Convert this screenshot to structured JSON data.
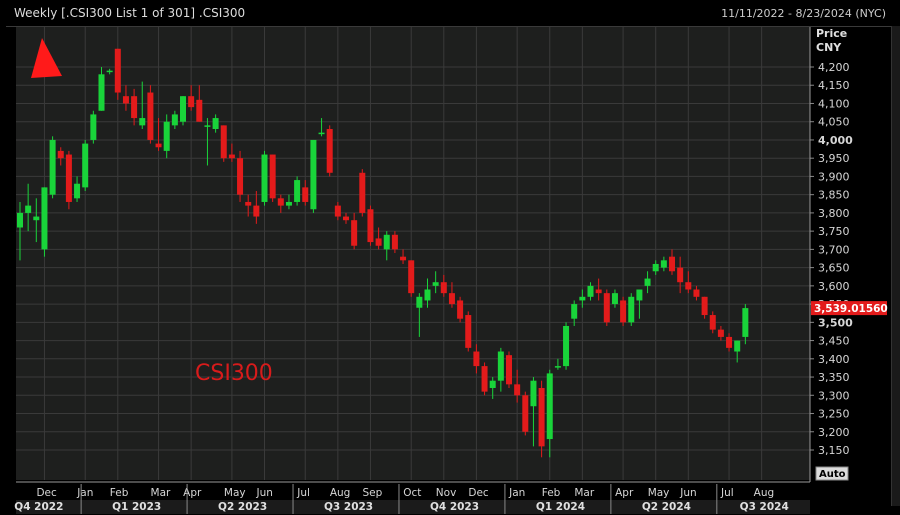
{
  "header": {
    "title": "Weekly [.CSI300 List 1 of 301] .CSI300",
    "date_range": "11/11/2022 - 8/23/2024 (NYC)"
  },
  "axis": {
    "price_label": "Price",
    "currency_label": "CNY",
    "auto_button": "Auto",
    "last_price_tag": "3,539.01560"
  },
  "watermark": "CSI300",
  "colors": {
    "up": "#19d43a",
    "down": "#e31b1b",
    "background": "#1e1f1e",
    "grid": "#3a3a3a",
    "marker": "#ff1a1a"
  },
  "chart_data": {
    "type": "candlestick",
    "title": "Weekly [.CSI300 List 1 of 301] .CSI300",
    "interval": "Weekly",
    "ylabel": "Price CNY",
    "ylim": [
      3120,
      4290
    ],
    "y_ticks": [
      3150,
      3200,
      3250,
      3300,
      3350,
      3400,
      3450,
      3500,
      3550,
      3600,
      3650,
      3700,
      3750,
      3800,
      3850,
      3900,
      3950,
      4000,
      4050,
      4100,
      4150,
      4200
    ],
    "y_tick_labels": [
      "3,150",
      "3,200",
      "3,250",
      "3,300",
      "3,350",
      "3,400",
      "3,450",
      "3,500",
      "3,550",
      "3,600",
      "3,650",
      "3,700",
      "3,750",
      "3,800",
      "3,850",
      "3,900",
      "3,950",
      "4,000",
      "4,050",
      "4,100",
      "4,150",
      "4,200"
    ],
    "month_labels": [
      "Dec",
      "Jan",
      "Feb",
      "Mar",
      "Apr",
      "May",
      "Jun",
      "Jul",
      "Aug",
      "Sep",
      "Oct",
      "Nov",
      "Dec",
      "Jan",
      "Feb",
      "Mar",
      "Apr",
      "May",
      "Jun",
      "Jul",
      "Aug"
    ],
    "month_label_week_index": [
      3,
      8,
      12,
      17,
      21,
      26,
      30,
      35,
      39,
      43,
      48,
      52,
      56,
      61,
      65,
      69,
      74,
      78,
      82,
      87,
      91
    ],
    "quarter_labels": [
      "Q4 2022",
      "Q1 2023",
      "Q2 2023",
      "Q3 2023",
      "Q4 2023",
      "Q1 2024",
      "Q2 2024",
      "Q3 2024"
    ],
    "quarter_label_week_index": [
      2,
      14,
      27,
      40,
      53,
      66,
      79,
      91
    ],
    "quarter_separator_week_index": [
      7.5,
      20.5,
      33.5,
      46.5,
      59.5,
      72.5,
      85.5
    ],
    "last_price": 3539.0156,
    "candles": [
      {
        "o": 3760,
        "h": 3830,
        "l": 3670,
        "c": 3800
      },
      {
        "o": 3800,
        "h": 3880,
        "l": 3750,
        "c": 3820
      },
      {
        "o": 3780,
        "h": 3840,
        "l": 3720,
        "c": 3790
      },
      {
        "o": 3700,
        "h": 3870,
        "l": 3680,
        "c": 3870
      },
      {
        "o": 3850,
        "h": 4010,
        "l": 3840,
        "c": 4000
      },
      {
        "o": 3970,
        "h": 3980,
        "l": 3930,
        "c": 3950
      },
      {
        "o": 3960,
        "h": 3970,
        "l": 3810,
        "c": 3830
      },
      {
        "o": 3840,
        "h": 3900,
        "l": 3830,
        "c": 3880
      },
      {
        "o": 3870,
        "h": 4000,
        "l": 3860,
        "c": 3990
      },
      {
        "o": 4000,
        "h": 4080,
        "l": 3990,
        "c": 4070
      },
      {
        "o": 4080,
        "h": 4200,
        "l": 4080,
        "c": 4180
      },
      {
        "o": 4190,
        "h": 4195,
        "l": 4180,
        "c": 4190
      },
      {
        "o": 4250,
        "h": 4250,
        "l": 4110,
        "c": 4130
      },
      {
        "o": 4120,
        "h": 4150,
        "l": 4080,
        "c": 4100
      },
      {
        "o": 4120,
        "h": 4140,
        "l": 4040,
        "c": 4060
      },
      {
        "o": 4040,
        "h": 4160,
        "l": 4030,
        "c": 4060
      },
      {
        "o": 4130,
        "h": 4150,
        "l": 3990,
        "c": 4000
      },
      {
        "o": 3990,
        "h": 4060,
        "l": 3970,
        "c": 3980
      },
      {
        "o": 3970,
        "h": 4070,
        "l": 3950,
        "c": 4050
      },
      {
        "o": 4040,
        "h": 4080,
        "l": 4030,
        "c": 4070
      },
      {
        "o": 4050,
        "h": 4120,
        "l": 4040,
        "c": 4120
      },
      {
        "o": 4120,
        "h": 4150,
        "l": 4080,
        "c": 4090
      },
      {
        "o": 4110,
        "h": 4150,
        "l": 4050,
        "c": 4050
      },
      {
        "o": 4040,
        "h": 4060,
        "l": 3930,
        "c": 4040
      },
      {
        "o": 4030,
        "h": 4070,
        "l": 4020,
        "c": 4060
      },
      {
        "o": 4040,
        "h": 4040,
        "l": 3940,
        "c": 3950
      },
      {
        "o": 3960,
        "h": 3990,
        "l": 3940,
        "c": 3950
      },
      {
        "o": 3950,
        "h": 3970,
        "l": 3830,
        "c": 3850
      },
      {
        "o": 3830,
        "h": 3850,
        "l": 3790,
        "c": 3820
      },
      {
        "o": 3820,
        "h": 3860,
        "l": 3770,
        "c": 3790
      },
      {
        "o": 3830,
        "h": 3970,
        "l": 3820,
        "c": 3960
      },
      {
        "o": 3960,
        "h": 3960,
        "l": 3830,
        "c": 3840
      },
      {
        "o": 3840,
        "h": 3850,
        "l": 3800,
        "c": 3820
      },
      {
        "o": 3820,
        "h": 3850,
        "l": 3810,
        "c": 3830
      },
      {
        "o": 3830,
        "h": 3900,
        "l": 3820,
        "c": 3890
      },
      {
        "o": 3870,
        "h": 3890,
        "l": 3820,
        "c": 3830
      },
      {
        "o": 3810,
        "h": 4000,
        "l": 3800,
        "c": 4000
      },
      {
        "o": 4020,
        "h": 4060,
        "l": 4010,
        "c": 4020
      },
      {
        "o": 4030,
        "h": 4040,
        "l": 3900,
        "c": 3910
      },
      {
        "o": 3820,
        "h": 3830,
        "l": 3780,
        "c": 3790
      },
      {
        "o": 3790,
        "h": 3800,
        "l": 3770,
        "c": 3780
      },
      {
        "o": 3780,
        "h": 3800,
        "l": 3700,
        "c": 3710
      },
      {
        "o": 3910,
        "h": 3920,
        "l": 3790,
        "c": 3800
      },
      {
        "o": 3810,
        "h": 3820,
        "l": 3710,
        "c": 3720
      },
      {
        "o": 3730,
        "h": 3760,
        "l": 3700,
        "c": 3710
      },
      {
        "o": 3700,
        "h": 3750,
        "l": 3670,
        "c": 3740
      },
      {
        "o": 3740,
        "h": 3750,
        "l": 3690,
        "c": 3700
      },
      {
        "o": 3680,
        "h": 3700,
        "l": 3660,
        "c": 3670
      },
      {
        "o": 3670,
        "h": 3670,
        "l": 3570,
        "c": 3580
      },
      {
        "o": 3540,
        "h": 3580,
        "l": 3460,
        "c": 3570
      },
      {
        "o": 3560,
        "h": 3620,
        "l": 3540,
        "c": 3590
      },
      {
        "o": 3600,
        "h": 3640,
        "l": 3580,
        "c": 3610
      },
      {
        "o": 3610,
        "h": 3630,
        "l": 3570,
        "c": 3580
      },
      {
        "o": 3580,
        "h": 3610,
        "l": 3540,
        "c": 3550
      },
      {
        "o": 3560,
        "h": 3570,
        "l": 3500,
        "c": 3510
      },
      {
        "o": 3520,
        "h": 3530,
        "l": 3420,
        "c": 3430
      },
      {
        "o": 3420,
        "h": 3440,
        "l": 3360,
        "c": 3380
      },
      {
        "o": 3380,
        "h": 3390,
        "l": 3300,
        "c": 3310
      },
      {
        "o": 3320,
        "h": 3350,
        "l": 3290,
        "c": 3340
      },
      {
        "o": 3340,
        "h": 3430,
        "l": 3310,
        "c": 3420
      },
      {
        "o": 3410,
        "h": 3420,
        "l": 3320,
        "c": 3330
      },
      {
        "o": 3330,
        "h": 3370,
        "l": 3280,
        "c": 3300
      },
      {
        "o": 3300,
        "h": 3310,
        "l": 3190,
        "c": 3200
      },
      {
        "o": 3270,
        "h": 3350,
        "l": 3160,
        "c": 3340
      },
      {
        "o": 3320,
        "h": 3340,
        "l": 3130,
        "c": 3160
      },
      {
        "o": 3180,
        "h": 3370,
        "l": 3130,
        "c": 3360
      },
      {
        "o": 3380,
        "h": 3400,
        "l": 3370,
        "c": 3380
      },
      {
        "o": 3380,
        "h": 3500,
        "l": 3370,
        "c": 3490
      },
      {
        "o": 3510,
        "h": 3560,
        "l": 3490,
        "c": 3550
      },
      {
        "o": 3560,
        "h": 3590,
        "l": 3540,
        "c": 3570
      },
      {
        "o": 3570,
        "h": 3610,
        "l": 3560,
        "c": 3600
      },
      {
        "o": 3590,
        "h": 3620,
        "l": 3560,
        "c": 3580
      },
      {
        "o": 3580,
        "h": 3590,
        "l": 3490,
        "c": 3500
      },
      {
        "o": 3550,
        "h": 3590,
        "l": 3540,
        "c": 3580
      },
      {
        "o": 3560,
        "h": 3570,
        "l": 3490,
        "c": 3500
      },
      {
        "o": 3500,
        "h": 3580,
        "l": 3490,
        "c": 3570
      },
      {
        "o": 3560,
        "h": 3590,
        "l": 3510,
        "c": 3590
      },
      {
        "o": 3600,
        "h": 3640,
        "l": 3580,
        "c": 3620
      },
      {
        "o": 3640,
        "h": 3670,
        "l": 3630,
        "c": 3660
      },
      {
        "o": 3650,
        "h": 3680,
        "l": 3640,
        "c": 3670
      },
      {
        "o": 3680,
        "h": 3700,
        "l": 3630,
        "c": 3640
      },
      {
        "o": 3650,
        "h": 3680,
        "l": 3580,
        "c": 3610
      },
      {
        "o": 3610,
        "h": 3640,
        "l": 3580,
        "c": 3590
      },
      {
        "o": 3590,
        "h": 3600,
        "l": 3560,
        "c": 3570
      },
      {
        "o": 3570,
        "h": 3570,
        "l": 3510,
        "c": 3520
      },
      {
        "o": 3520,
        "h": 3530,
        "l": 3470,
        "c": 3480
      },
      {
        "o": 3480,
        "h": 3490,
        "l": 3450,
        "c": 3460
      },
      {
        "o": 3460,
        "h": 3470,
        "l": 3420,
        "c": 3430
      },
      {
        "o": 3420,
        "h": 3450,
        "l": 3390,
        "c": 3450
      },
      {
        "o": 3460,
        "h": 3550,
        "l": 3440,
        "c": 3539.0156
      }
    ]
  }
}
